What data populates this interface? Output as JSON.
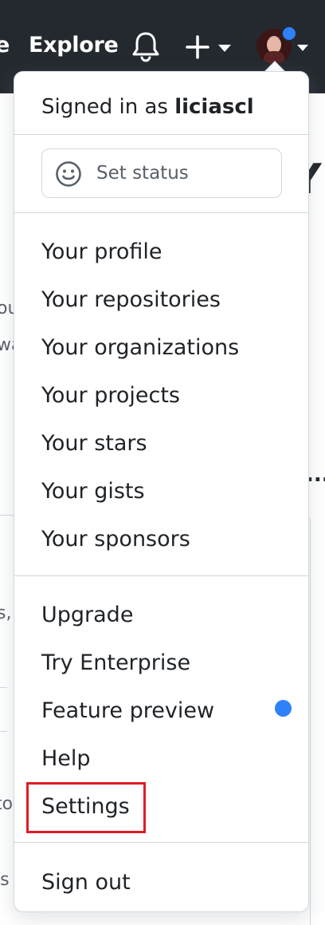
{
  "nav": {
    "cut_text": "e",
    "explore_label": "Explore",
    "bell_icon": "bell-icon",
    "plus_icon": "plus-icon",
    "caret_icon": "triangle-down-icon",
    "avatar_alt": "avatar",
    "notification_color": "#2f81f7"
  },
  "background": {
    "heading_fragment": "Y",
    "text_fragments": [
      "ou",
      "wa",
      "s,",
      "to",
      "is"
    ],
    "ellipsis": "..."
  },
  "menu": {
    "signed_in_prefix": "Signed in as ",
    "username": "liciascl",
    "set_status": "Set status",
    "section_profile": [
      "Your profile",
      "Your repositories",
      "Your organizations",
      "Your projects",
      "Your stars",
      "Your gists",
      "Your sponsors"
    ],
    "section_misc": [
      "Upgrade",
      "Try Enterprise",
      "Feature preview",
      "Help",
      "Settings"
    ],
    "sign_out": "Sign out",
    "highlight_color": "#e01b24",
    "accent_color": "#2f81f7"
  }
}
